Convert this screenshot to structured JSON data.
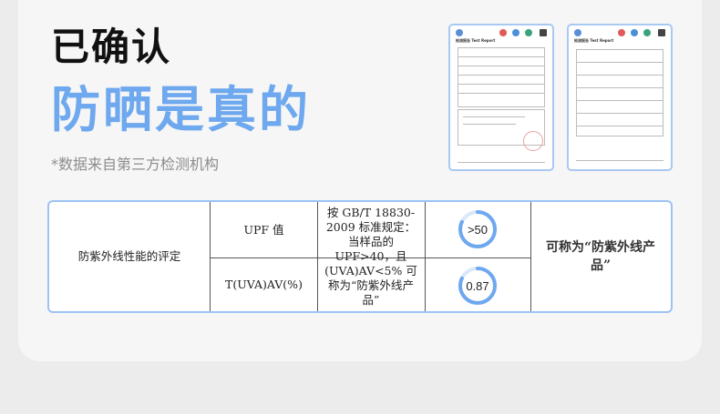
{
  "header": {
    "line1": "已确认",
    "line2": "防晒是真的",
    "note": "*数据来自第三方检测机构"
  },
  "reports": [
    {
      "title": "检测报告 Test Report"
    },
    {
      "title": "检测报告 Test Report"
    }
  ],
  "table": {
    "category": "防紫外线性能的评定",
    "items": [
      {
        "label": "UPF 值",
        "result": ">50",
        "fill": 0.82
      },
      {
        "label": "T(UVA)AV(%)",
        "result": "0.87",
        "fill": 0.82
      }
    ],
    "standard": "按 GB/T 18830-2009 标准规定：当样品的 UPF>40，且 (UVA)AV<5% 可称为“防紫外线产品”",
    "conclusion": "可称为“防紫外线产品”"
  },
  "colors": {
    "accent": "#6ea8ee",
    "border": "#9dc3f5"
  }
}
